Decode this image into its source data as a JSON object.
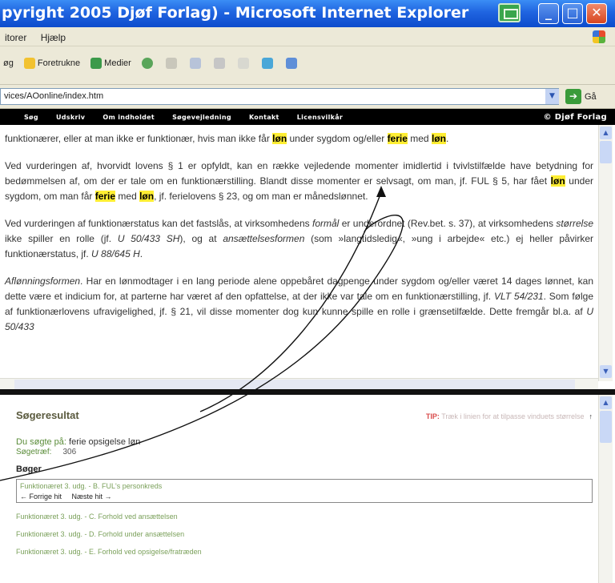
{
  "window": {
    "title": "pyright 2005 Djøf Forlag) - Microsoft Internet Explorer",
    "min": "_",
    "max": "□",
    "close": "✕"
  },
  "menu": [
    "itorer",
    "Hjælp"
  ],
  "toolbar": {
    "search": "øg",
    "favorites": "Foretrukne",
    "media": "Medier"
  },
  "address": {
    "url": "vices/AOonline/index.htm",
    "go": "Gå"
  },
  "sitenav": {
    "items": [
      "Søg",
      "Udskriv",
      "Om indholdet",
      "Søgevejledning",
      "Kontakt",
      "Licensvilkår"
    ],
    "copyright": "© Djøf Forlag"
  },
  "upper": {
    "p1": {
      "a": "funktionærer, eller at man ikke er funktionær, hvis man ikke får ",
      "h1": "løn",
      "b": " under sygdom og/eller ",
      "h2": "ferie",
      "c": " med ",
      "h3": "løn",
      "d": "."
    },
    "p2": {
      "a": "Ved vurderingen af, hvorvidt lovens § 1 er opfyldt, kan en række vejledende momenter imidlertid i tvivlstilfælde have betydning for bedømmelsen af, om der er tale om en funktionærstilling. Blandt disse momenter er selvsagt, om man, jf. FUL § 5, har fået ",
      "h1": "løn",
      "b": " under sygdom, om man får ",
      "h2": "ferie",
      "c": " med ",
      "h3": "løn",
      "d": ", jf. ferielovens § 23, og om man er månedslønnet."
    },
    "p3": {
      "a": "Ved vurderingen af funktionærstatus kan det fastslås, at virksomhedens ",
      "i1": "formål",
      "b": " er underordnet (Rev.bet. s. 37), at virksomhedens ",
      "i2": "størrelse",
      "c": " ikke spiller en rolle (jf. ",
      "i3": "U 50/433 SH",
      "d": "), og at ",
      "i4": "ansættelsesformen",
      "e": " (som »langtidsledig«, »ung i arbejde« etc.) ej heller påvirker funktionærstatus, jf. ",
      "i5": "U 88/645 H",
      "f": "."
    },
    "p4": {
      "i1": "Aflønningsformen",
      "a": ". Har en lønmodtager i en lang periode alene oppebåret dagpenge under sygdom og/eller været 14 dages lønnet, kan dette være et indicium for, at parterne har været af den opfattelse, at der ikke var tale om en funktionærstilling, jf. ",
      "i2": "VLT 54/231",
      "b": ". Som følge af funktionærlovens ufravigelighed, jf. § 21, vil disse momenter dog kun kunne spille en rolle i grænsetilfælde. Dette fremgår bl.a. af ",
      "i3": "U 50/433"
    }
  },
  "lower": {
    "title": "Søgeresultat",
    "tip_label": "TIP:",
    "tip_text": "Træk i linien for at tilpasse vinduets størrelse",
    "tip_arrow": "↑",
    "query_label": "Du søgte på:",
    "query": "ferie opsigelse løn",
    "count_label": "Søgetræf:",
    "count": "306",
    "books": "Bøger",
    "selected": "Funktionæret 3. udg. - B. FUL's personkreds",
    "prev": "← Forrige hit",
    "next": "Næste hit →",
    "results": [
      "Funktionæret 3. udg. - C. Forhold ved ansættelsen",
      "Funktionæret 3. udg. - D. Forhold under ansættelsen",
      "Funktionæret 3. udg. - E. Forhold ved opsigelse/fratræden"
    ]
  },
  "colors": {
    "highlight": "#ffee33",
    "link_green": "#7aa05a",
    "title_bar": "#1f64e0"
  }
}
